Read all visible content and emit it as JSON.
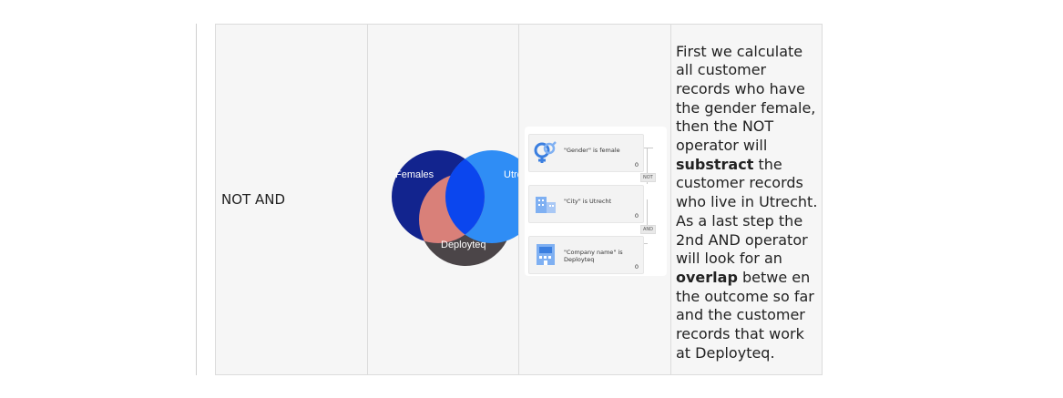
{
  "row": {
    "operator": "NOT AND",
    "venn": {
      "labels": {
        "a": "Females",
        "b": "Utrecht",
        "c": "Deployteq"
      },
      "colors": {
        "a": "#12248e",
        "b": "#2f8df5",
        "c": "#4b4548",
        "ac": "#d98079",
        "ab": "#0b46ee"
      }
    },
    "rules": [
      {
        "icon": "gender-icon",
        "pre": "\"Gender\" is ",
        "val": "female",
        "count": "0"
      },
      {
        "icon": "building-icon",
        "pre": "\"City\" is ",
        "val": "Utrecht",
        "count": "0"
      },
      {
        "icon": "company-icon",
        "pre": "\"Company name\" is ",
        "val": "Deployteq",
        "count": "0"
      }
    ],
    "operators": [
      "NOT",
      "AND"
    ],
    "description": {
      "p1": "First we calculate all customer records who have the gender female, then the NOT operator will ",
      "b1": "substract",
      "p2": " the customer records who live in Utrecht. As a last step the 2nd AND operator will look for an ",
      "b2": "overlap",
      "p3": " betwe en the outcome so far and the customer records that work at Deployteq."
    }
  }
}
